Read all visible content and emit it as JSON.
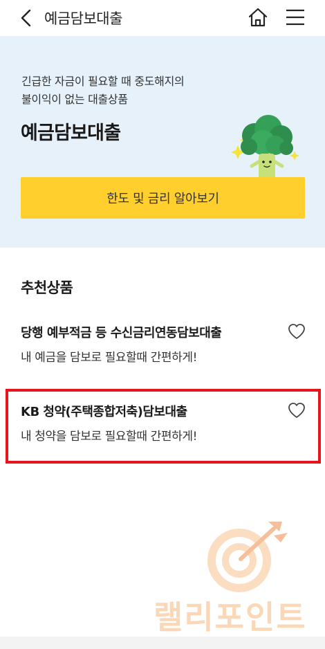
{
  "header": {
    "title": "예금담보대출",
    "back_icon": "chevron-left-icon",
    "home_icon": "home-icon",
    "menu_icon": "hamburger-menu-icon"
  },
  "hero": {
    "desc_line1": "긴급한 자금이 필요할 때 중도해지의",
    "desc_line2": "불이익이 없는 대출상품",
    "title": "예금담보대출",
    "button_label": "한도 및 금리 알아보기",
    "mascot_icon": "broccoli-mascot-icon"
  },
  "recommended": {
    "title": "추천상품",
    "items": [
      {
        "title": "당행 예부적금 등 수신금리연동담보대출",
        "subtitle": "내 예금을 담보로 필요할때 간편하게!",
        "favorite_icon": "heart-outline-icon",
        "highlighted": false
      },
      {
        "title": "KB 청약(주택종합저축)담보대출",
        "subtitle": "내 청약을 담보로 필요할때 간편하게!",
        "favorite_icon": "heart-outline-icon",
        "highlighted": true
      }
    ]
  },
  "watermark": {
    "text": "랠리포인트",
    "icon": "target-arrow-icon"
  },
  "colors": {
    "hero_bg": "#e6f1fa",
    "button_yellow": "#ffcf2e",
    "highlight_red": "#e8131b",
    "watermark_orange": "#f6b87e"
  }
}
